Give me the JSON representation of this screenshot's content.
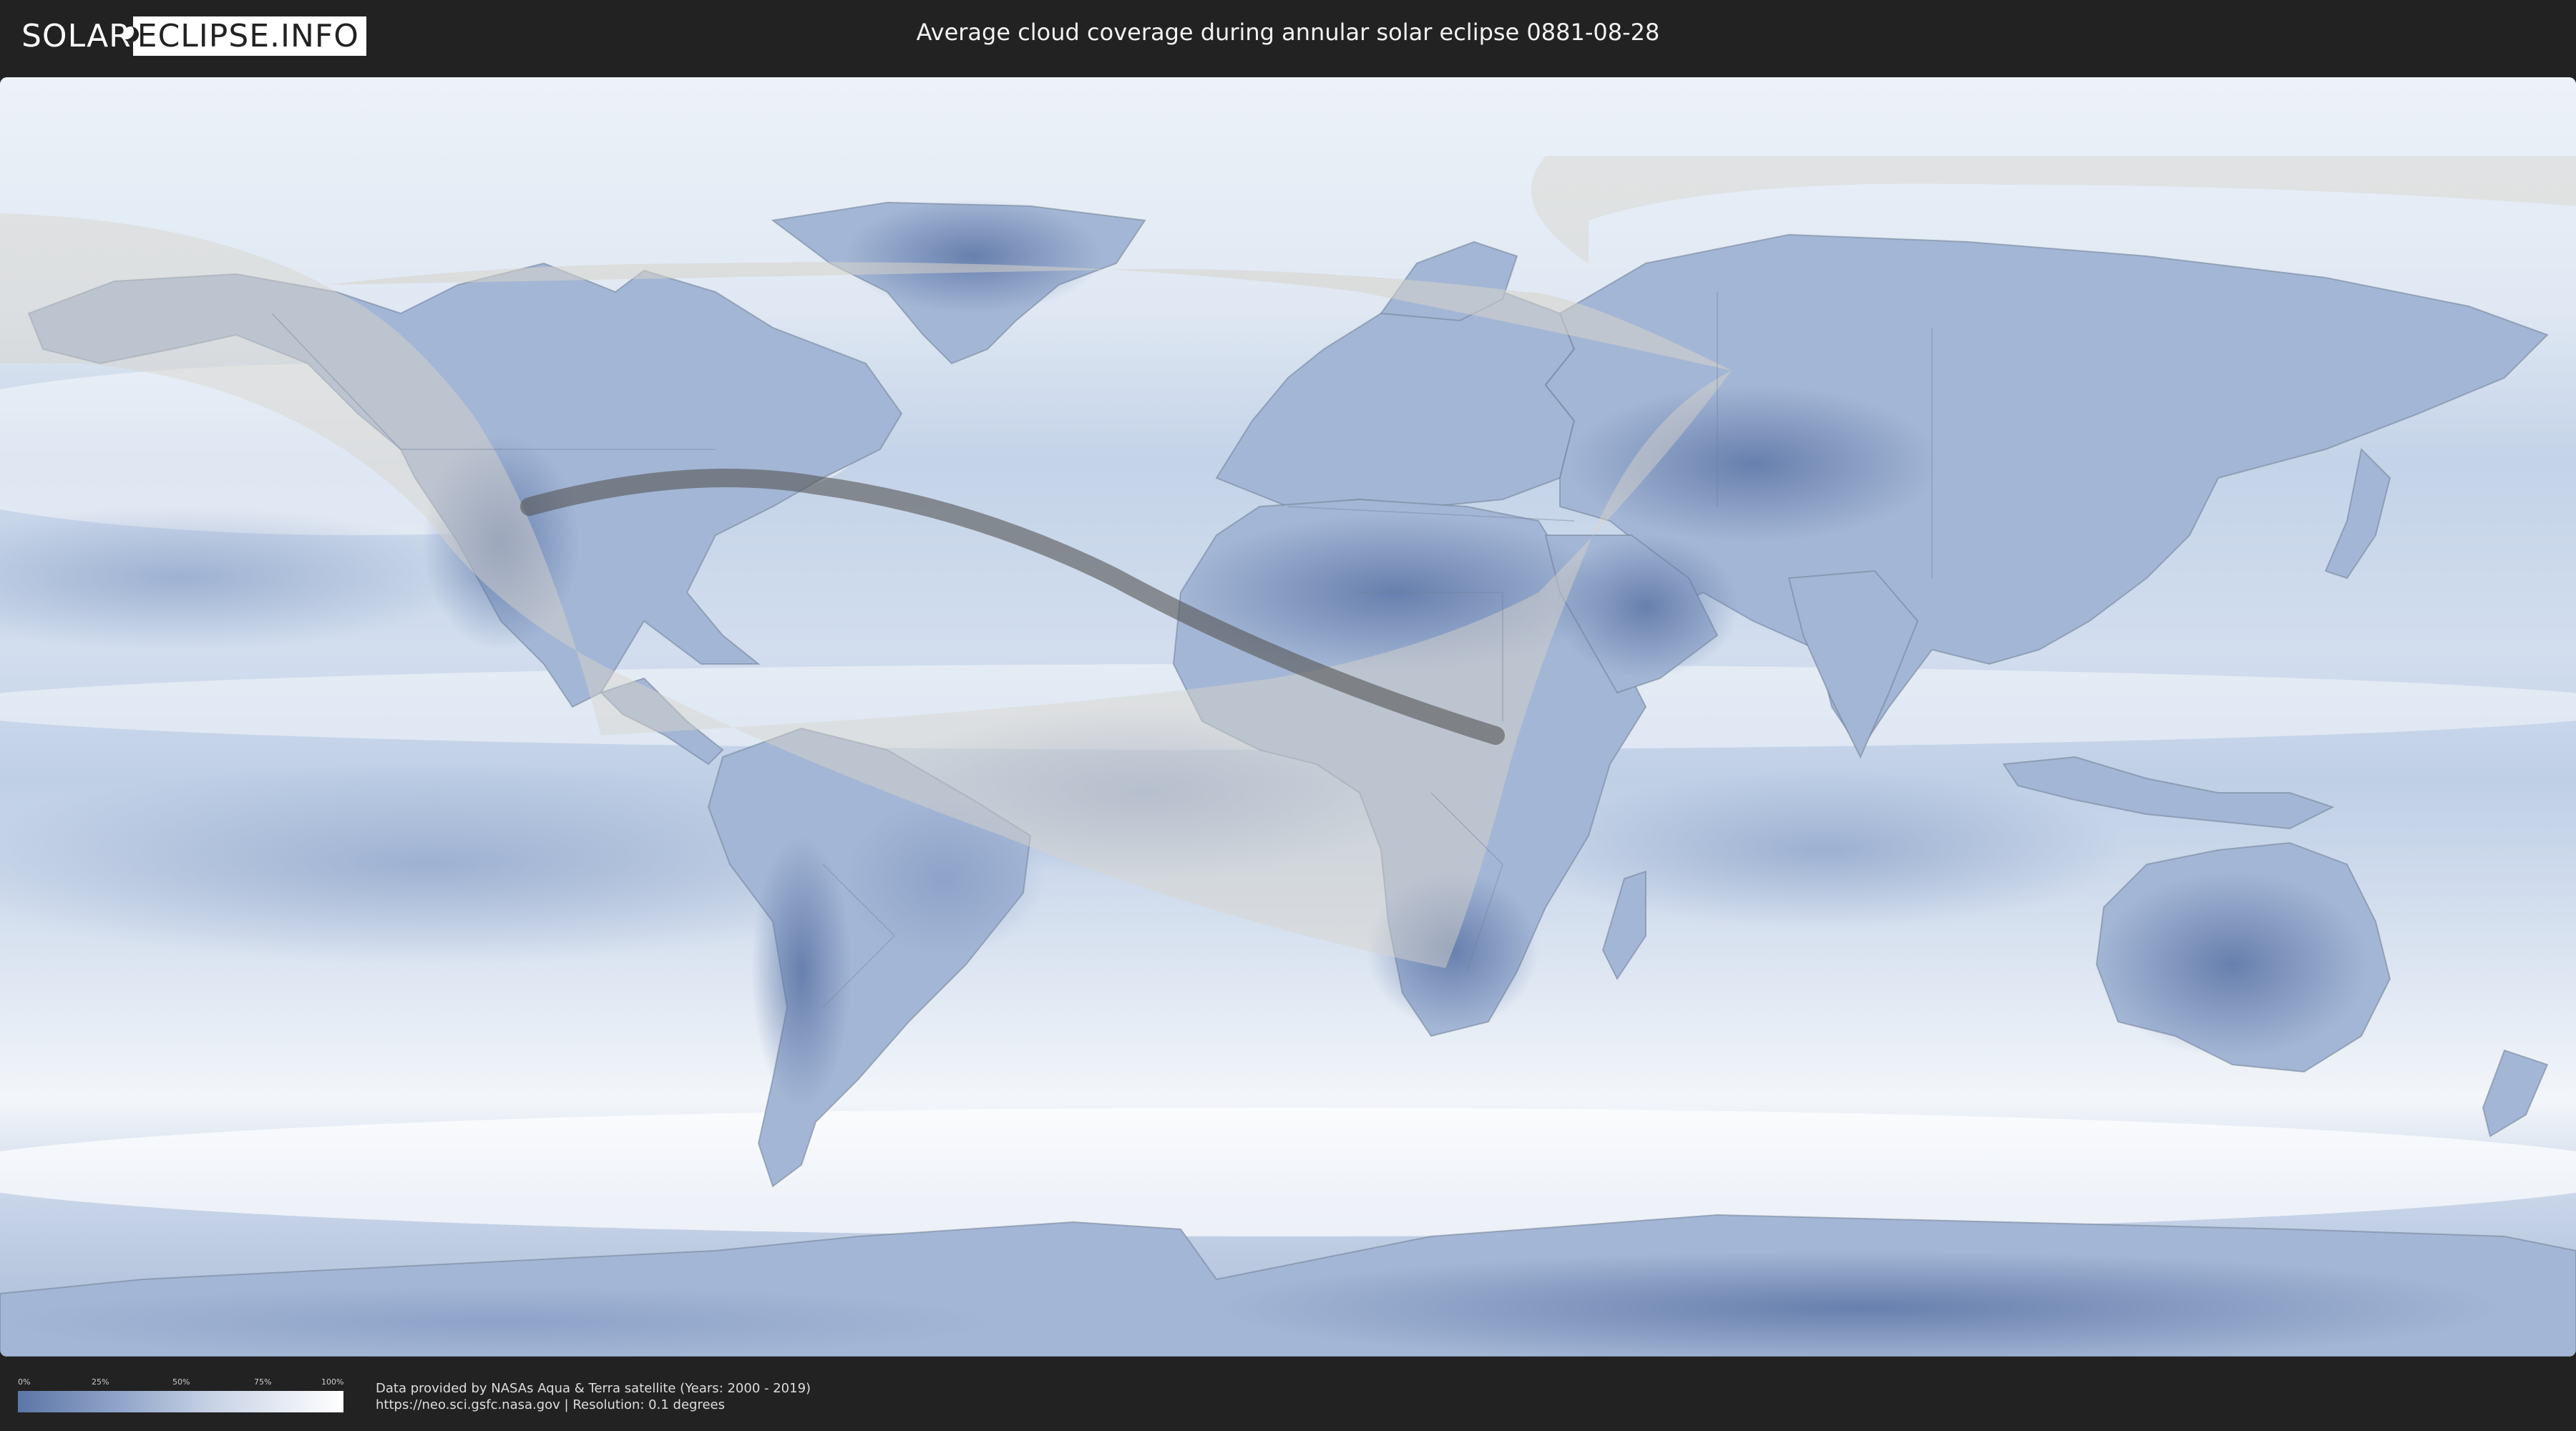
{
  "header": {
    "logo_part1": "SOLAR",
    "logo_part2": "ECLIPSE.INFO",
    "title": "Average cloud coverage during annular solar eclipse 0881-08-28"
  },
  "map": {
    "colors": {
      "clear": "#5c76a6",
      "medium": "#a9bad8",
      "cloudy": "#ffffff",
      "eclipse_shadow_overlay": "#d6d2cc",
      "central_path": "#555555",
      "borders": "#6f7f96"
    }
  },
  "legend": {
    "ticks": [
      "0%",
      "25%",
      "50%",
      "75%",
      "100%"
    ]
  },
  "credits": {
    "line1": "Data provided by NASAs Aqua & Terra satellite (Years: 2000 - 2019)",
    "line2": "https://neo.sci.gsfc.nasa.gov | Resolution: 0.1 degrees"
  }
}
